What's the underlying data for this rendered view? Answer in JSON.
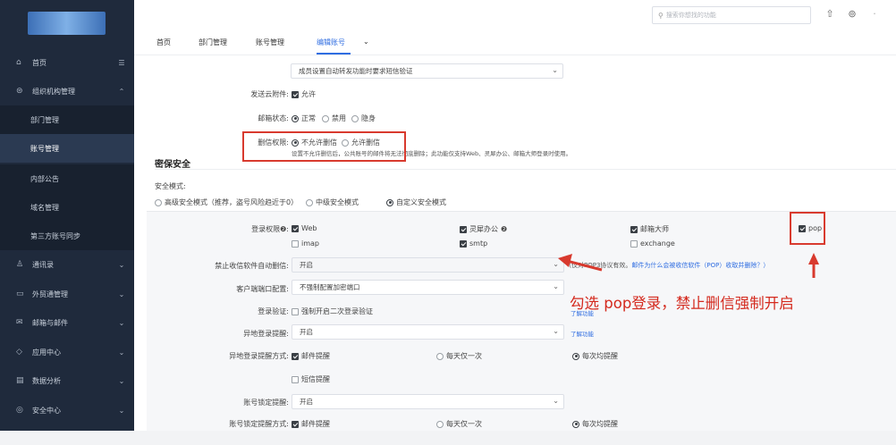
{
  "search": {
    "placeholder": "搜索你想找的功能"
  },
  "sidebar": {
    "items": [
      {
        "label": "首页",
        "icon": "⌂",
        "arrow": "☰",
        "icon_name": "home-icon",
        "arrow_name": "menu-icon"
      },
      {
        "label": "组织机构管理",
        "icon": "⊜",
        "arrow": "⌃",
        "icon_name": "org-icon",
        "arrow_name": "chevron-up-icon"
      },
      {
        "label": "通讯录",
        "icon": "♙",
        "arrow": "⌄",
        "icon_name": "contacts-icon",
        "arrow_name": "chevron-down-icon"
      },
      {
        "label": "外贸通管理",
        "icon": "▭",
        "arrow": "⌄",
        "icon_name": "trade-icon",
        "arrow_name": "chevron-down-icon"
      },
      {
        "label": "邮箱与邮件",
        "icon": "✉",
        "arrow": "⌄",
        "icon_name": "mail-icon",
        "arrow_name": "chevron-down-icon"
      },
      {
        "label": "应用中心",
        "icon": "◇",
        "arrow": "⌄",
        "icon_name": "apps-icon",
        "arrow_name": "chevron-down-icon"
      },
      {
        "label": "数据分析",
        "icon": "▤",
        "arrow": "⌄",
        "icon_name": "analytics-icon",
        "arrow_name": "chevron-down-icon"
      },
      {
        "label": "安全中心",
        "icon": "◎",
        "arrow": "⌄",
        "icon_name": "security-icon",
        "arrow_name": "chevron-down-icon"
      }
    ],
    "subitems": [
      {
        "label": "部门管理"
      },
      {
        "label": "账号管理"
      },
      {
        "label": "内部公告"
      },
      {
        "label": "域名管理"
      },
      {
        "label": "第三方账号同步"
      }
    ]
  },
  "tabs": [
    {
      "label": "首页"
    },
    {
      "label": "部门管理"
    },
    {
      "label": "账号管理"
    },
    {
      "label": "编辑账号"
    }
  ],
  "tabs_more": "⌄",
  "form": {
    "sms_select": "成员设置自动转发功能时要求短信验证",
    "cloud_attach_label": "发送云附件:",
    "cloud_attach_option": "允许",
    "mailbox_status_label": "邮箱状态:",
    "mailbox_status_options": [
      "正常",
      "禁用",
      "隐身"
    ],
    "delete_perm_label": "删信权限:",
    "delete_perm_options": [
      "不允许删信",
      "允许删信"
    ],
    "delete_perm_note": "设置不允许删信后，公共账号的邮件将无法彻底删除；此功能仅支持Web、灵犀办公、邮箱大师登录时使用。"
  },
  "security": {
    "title": "密保安全",
    "mode_label": "安全模式:",
    "mode_options": [
      "高级安全模式（推荐，盗号风险趋近于0）",
      "中级安全模式",
      "自定义安全模式"
    ],
    "login_perm_label": "登录权限",
    "login_perm_help": "❷",
    "login_options": [
      {
        "label": "Web",
        "checked": true
      },
      {
        "label": "灵犀办公",
        "checked": true
      },
      {
        "label": "邮箱大师",
        "checked": true
      },
      {
        "label": "pop",
        "checked": true
      },
      {
        "label": "imap",
        "checked": false
      },
      {
        "label": "smtp",
        "checked": true
      },
      {
        "label": "exchange",
        "checked": false
      }
    ],
    "auto_delete_label": "禁止收信软件自动删信:",
    "auto_delete_value": "开启",
    "auto_delete_note": "仅对POP3协议有效。",
    "auto_delete_link": "邮件为什么会被收信软件（POP）收取并删除？）",
    "auto_delete_note_prefix": "（",
    "client_port_label": "客户端端口配置:",
    "client_port_value": "不强制配置加密端口",
    "login_verify_label": "登录验证:",
    "login_verify_option": "强制开启二次登录验证",
    "learn_more": "了解功能",
    "remote_login_label": "异地登录提醒:",
    "remote_login_value": "开启",
    "remote_method_label": "异地登录提醒方式:",
    "remind_options": [
      "邮件提醒",
      "每天仅一次",
      "每次均提醒",
      "短信提醒"
    ],
    "lock_label": "账号锁定提醒:",
    "lock_value": "开启",
    "lock_method_label": "账号锁定提醒方式:"
  },
  "annotation": {
    "text": "勾选 pop登录，禁止删信强制开启"
  },
  "colors": {
    "accent": "#2f6de1",
    "annotation": "#d83a2e",
    "sidebar": "#1f2a3c"
  }
}
